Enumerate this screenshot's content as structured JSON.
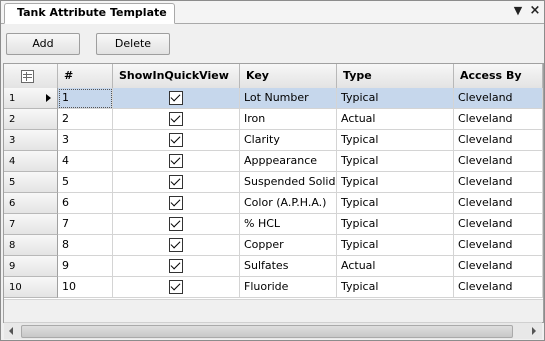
{
  "tab": {
    "title": "Tank Attribute Template",
    "menu_glyph": "▼",
    "close_glyph": "×"
  },
  "toolbar": {
    "add_label": "Add",
    "delete_label": "Delete"
  },
  "grid": {
    "columns": [
      "#",
      "ShowInQuickView",
      "Key",
      "Type",
      "Access By"
    ],
    "rows": [
      {
        "row_header": "1",
        "num": "1",
        "show": true,
        "key": "Lot Number",
        "type": "Typical",
        "access": "Cleveland"
      },
      {
        "row_header": "2",
        "num": "2",
        "show": true,
        "key": "Iron",
        "type": "Actual",
        "access": "Cleveland"
      },
      {
        "row_header": "3",
        "num": "3",
        "show": true,
        "key": "Clarity",
        "type": "Typical",
        "access": "Cleveland"
      },
      {
        "row_header": "4",
        "num": "4",
        "show": true,
        "key": "Apppearance",
        "type": "Typical",
        "access": "Cleveland"
      },
      {
        "row_header": "5",
        "num": "5",
        "show": true,
        "key": "Suspended Solids",
        "type": "Typical",
        "access": "Cleveland"
      },
      {
        "row_header": "6",
        "num": "6",
        "show": true,
        "key": "Color (A.P.H.A.)",
        "type": "Typical",
        "access": "Cleveland"
      },
      {
        "row_header": "7",
        "num": "7",
        "show": true,
        "key": "% HCL",
        "type": "Typical",
        "access": "Cleveland"
      },
      {
        "row_header": "8",
        "num": "8",
        "show": true,
        "key": "Copper",
        "type": "Typical",
        "access": "Cleveland"
      },
      {
        "row_header": "9",
        "num": "9",
        "show": true,
        "key": "Sulfates",
        "type": "Actual",
        "access": "Cleveland"
      },
      {
        "row_header": "10",
        "num": "10",
        "show": true,
        "key": "Fluoride",
        "type": "Typical",
        "access": "Cleveland"
      }
    ],
    "selected_row": 0
  },
  "colors": {
    "selection": "#c6d7ec",
    "grid_line": "#d4d4d4"
  }
}
